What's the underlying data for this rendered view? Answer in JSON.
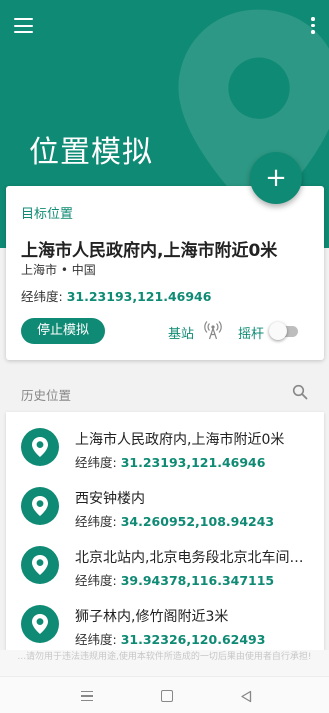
{
  "header": {
    "title": "位置模拟",
    "menu_icon": "menu-icon",
    "more_icon": "more-vert-icon",
    "fab_label": "+"
  },
  "target": {
    "section_label": "目标位置",
    "name": "上海市人民政府内,上海市附近0米",
    "region": "上海市 • 中国",
    "coord_label": "经纬度:",
    "coord_value": "31.23193,121.46946",
    "stop_button": "停止模拟",
    "station_label": "基站",
    "station_icon": "antenna-icon",
    "rocker_label": "摇杆",
    "rocker_enabled": false
  },
  "history": {
    "label": "历史位置",
    "search_icon": "search-icon",
    "items": [
      {
        "name": "上海市人民政府内,上海市附近0米",
        "coord_label": "经纬度:",
        "coord": "31.23193,121.46946"
      },
      {
        "name": "西安钟楼内",
        "coord_label": "经纬度:",
        "coord": "34.260952,108.94243"
      },
      {
        "name": "北京北站内,北京电务段北京北车间附近",
        "coord_label": "经纬度:",
        "coord": "39.94378,116.347115"
      },
      {
        "name": "狮子林内,修竹阁附近3米",
        "coord_label": "经纬度:",
        "coord": "31.32326,120.62493"
      }
    ]
  },
  "footer_note": "...请勿用于违法违规用途,使用本软件所造成的一切后果由使用者自行承担!",
  "colors": {
    "accent": "#0f8a74",
    "background": "#f2f2f2"
  }
}
